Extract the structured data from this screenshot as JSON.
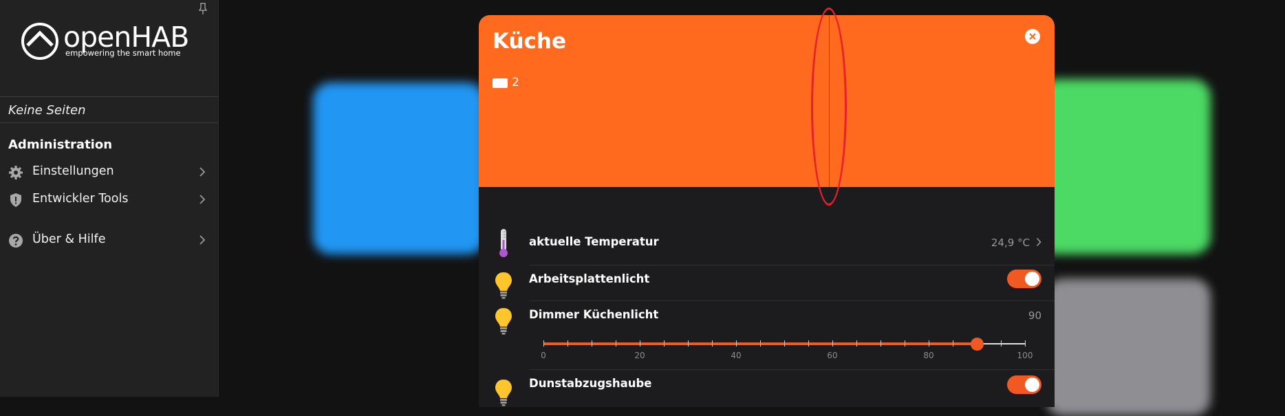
{
  "sidebar": {
    "logo_text": "openHAB",
    "logo_tagline": "empowering the smart home",
    "no_pages": "Keine Seiten",
    "section_title": "Administration",
    "items": [
      {
        "label": "Einstellungen",
        "icon": "gear-icon"
      },
      {
        "label": "Entwickler Tools",
        "icon": "shield-icon"
      },
      {
        "label": "Über & Hilfe",
        "icon": "help-icon"
      }
    ]
  },
  "modal": {
    "title": "Küche",
    "count": "2",
    "colors": {
      "header": "#ff6a1f",
      "accent": "#f05a22"
    },
    "rows": [
      {
        "label": "aktuelle Temperatur",
        "value": "24,9 °C",
        "icon": "thermometer-icon"
      },
      {
        "label": "Arbeitsplattenlicht",
        "icon": "bulb-icon",
        "toggle": true
      },
      {
        "label": "Dimmer Küchenlicht",
        "value": "90",
        "icon": "bulb-icon"
      },
      {
        "label": "Dunstabzugshaube",
        "icon": "bulb-icon",
        "toggle": true
      }
    ],
    "slider": {
      "min": 0,
      "max": 100,
      "value": 90,
      "tick_labels": [
        "0",
        "20",
        "40",
        "60",
        "80",
        "100"
      ]
    }
  }
}
